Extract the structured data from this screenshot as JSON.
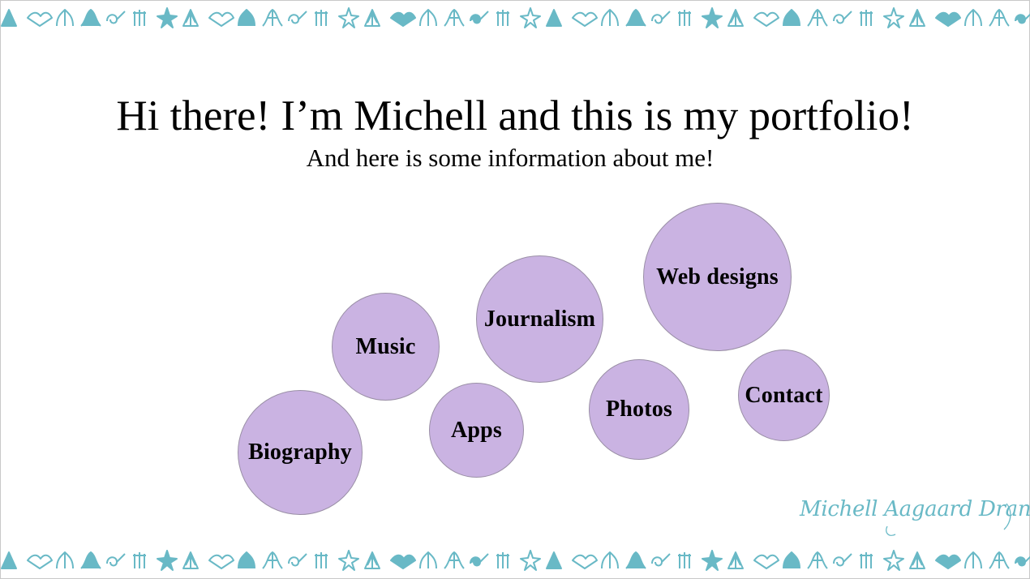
{
  "page": {
    "title": "Hi there! I’m Michell and this is my portfolio!",
    "subtitle": "And here is some information about me!"
  },
  "nav_bubbles": [
    {
      "label": "Biography"
    },
    {
      "label": "Music"
    },
    {
      "label": "Apps"
    },
    {
      "label": "Journalism"
    },
    {
      "label": "Photos"
    },
    {
      "label": "Web designs"
    },
    {
      "label": "Contact"
    }
  ],
  "signature": {
    "text": "Michell Aagaard Dranig"
  },
  "colors": {
    "bubble_fill": "#cab3e2",
    "bubble_border": "#9a8fa6",
    "ornament": "#69b9c6",
    "text": "#000000"
  },
  "icons": {
    "border_top": "ornamental-border-pattern",
    "border_bottom": "ornamental-border-pattern"
  }
}
